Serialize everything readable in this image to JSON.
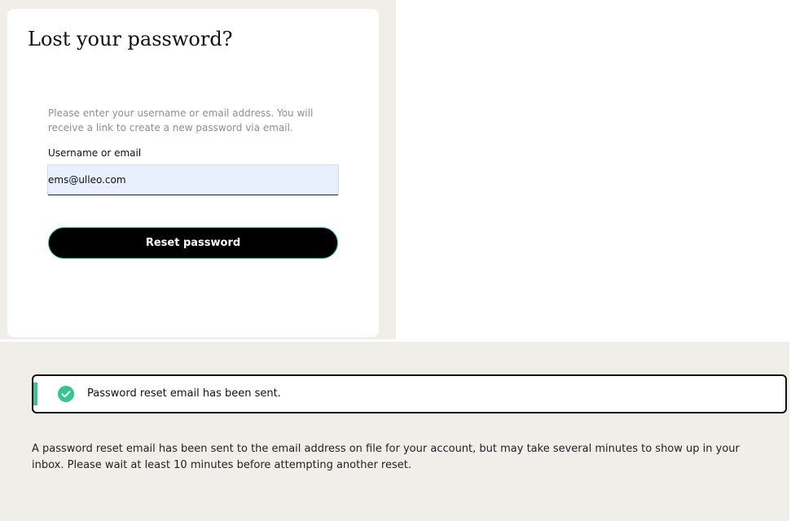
{
  "form": {
    "title": "Lost your password?",
    "instructions": "Please enter your username or email address. You will receive a link to create a new password via email.",
    "field_label": "Username or email",
    "email_value": "ems@ulleo.com",
    "submit_label": "Reset password"
  },
  "notice": {
    "message": "Password reset email has been sent.",
    "icon": "check-circle-icon",
    "accent_color": "#35c690"
  },
  "detail": {
    "text": "A password reset email has been sent to the email address on file for your account, but may take several minutes to show up in your inbox. Please wait at least 10 minutes before attempting another reset."
  },
  "colors": {
    "panel_background": "#efeee9",
    "button_background": "#000000",
    "button_border": "#2ec4a5",
    "input_background": "#e8f0fe"
  }
}
